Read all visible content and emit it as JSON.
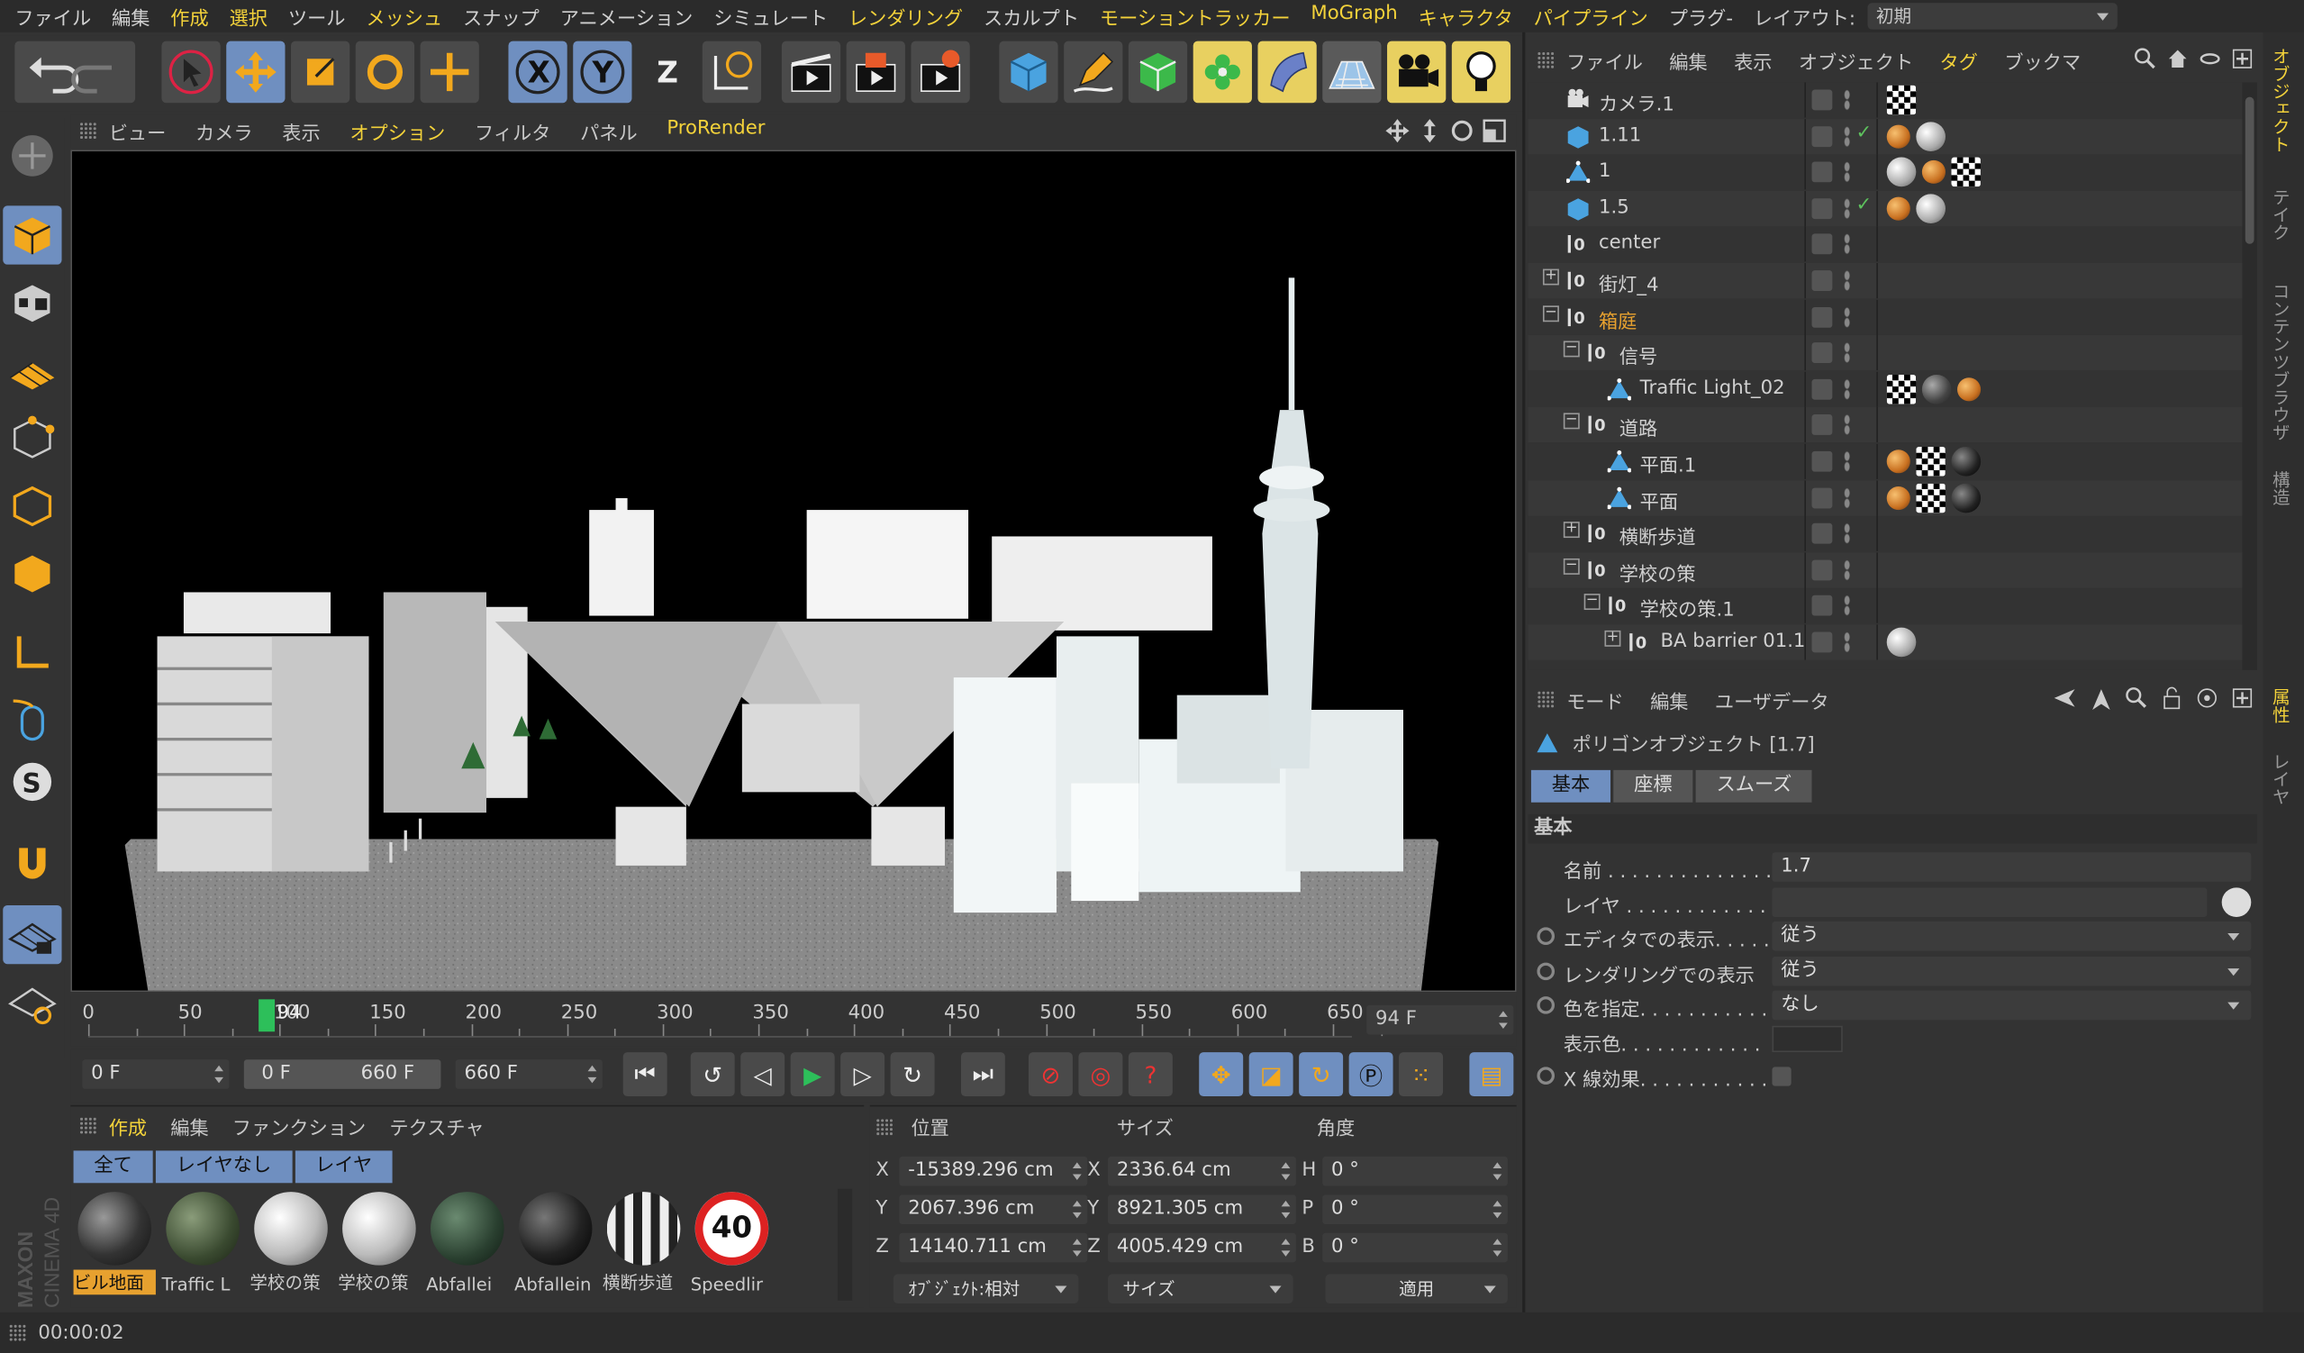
{
  "menubar": {
    "items": [
      {
        "label": "ファイル",
        "hl": false
      },
      {
        "label": "編集",
        "hl": false
      },
      {
        "label": "作成",
        "hl": true
      },
      {
        "label": "選択",
        "hl": true
      },
      {
        "label": "ツール",
        "hl": false
      },
      {
        "label": "メッシュ",
        "hl": true
      },
      {
        "label": "スナップ",
        "hl": false
      },
      {
        "label": "アニメーション",
        "hl": false
      },
      {
        "label": "シミュレート",
        "hl": false
      },
      {
        "label": "レンダリング",
        "hl": true
      },
      {
        "label": "スカルプト",
        "hl": false
      },
      {
        "label": "モーショントラッカー",
        "hl": true
      },
      {
        "label": "MoGraph",
        "hl": true
      },
      {
        "label": "キャラクタ",
        "hl": true
      },
      {
        "label": "パイプライン",
        "hl": true
      },
      {
        "label": "プラグ-",
        "hl": false
      }
    ],
    "layout_label": "レイアウト:",
    "layout_value": "初期"
  },
  "viewport_menu": [
    {
      "label": "ビュー",
      "hl": false
    },
    {
      "label": "カメラ",
      "hl": false
    },
    {
      "label": "表示",
      "hl": false
    },
    {
      "label": "オプション",
      "hl": true
    },
    {
      "label": "フィルタ",
      "hl": false
    },
    {
      "label": "パネル",
      "hl": false
    },
    {
      "label": "ProRender",
      "hl": true
    }
  ],
  "timeline": {
    "ticks": [
      "0",
      "50",
      "100",
      "150",
      "200",
      "250",
      "300",
      "350",
      "400",
      "450",
      "500",
      "550",
      "600",
      "650"
    ],
    "current": "94",
    "current_frame_field": "94 F",
    "max_frame": 660
  },
  "transport": {
    "start": "0 F",
    "range_start": "0 F",
    "range_end": "660 F",
    "end": "660 F"
  },
  "materials": {
    "menu": [
      {
        "label": "作成",
        "hl": true
      },
      {
        "label": "編集",
        "hl": false
      },
      {
        "label": "ファンクション",
        "hl": false
      },
      {
        "label": "テクスチャ",
        "hl": false
      }
    ],
    "tabs": [
      "全て",
      "レイヤなし",
      "レイヤ"
    ],
    "items": [
      {
        "label": "ビル地面",
        "style": "dark",
        "selected": true
      },
      {
        "label": "Traffic L",
        "style": "green",
        "selected": false
      },
      {
        "label": "学校の策",
        "style": "white",
        "selected": false
      },
      {
        "label": "学校の策",
        "style": "white",
        "selected": false
      },
      {
        "label": "Abfallei",
        "style": "darkgreen",
        "selected": false
      },
      {
        "label": "Abfallein",
        "style": "black",
        "selected": false
      },
      {
        "label": "横断歩道",
        "style": "stripe",
        "selected": false
      },
      {
        "label": "Speedlir",
        "style": "sign",
        "selected": false
      }
    ],
    "sign_text": "40"
  },
  "coords": {
    "headers": {
      "position": "位置",
      "size": "サイズ",
      "angle": "角度"
    },
    "axes": [
      {
        "pl": "X",
        "pv": "-15389.296 cm",
        "sl": "X",
        "sv": "2336.64 cm",
        "al": "H",
        "av": "0 °"
      },
      {
        "pl": "Y",
        "pv": "2067.396 cm",
        "sl": "Y",
        "sv": "8921.305 cm",
        "al": "P",
        "av": "0 °"
      },
      {
        "pl": "Z",
        "pv": "14140.711 cm",
        "sl": "Z",
        "sv": "4005.429 cm",
        "al": "B",
        "av": "0 °"
      }
    ],
    "mode": "ｵﾌﾞｼﾞｪｸﾄ:相対",
    "size_mode": "サイズ",
    "apply": "適用"
  },
  "status": {
    "time": "00:00:02"
  },
  "object_manager": {
    "menu": [
      {
        "label": "ファイル",
        "hl": false
      },
      {
        "label": "編集",
        "hl": false
      },
      {
        "label": "表示",
        "hl": false
      },
      {
        "label": "オブジェクト",
        "hl": false
      },
      {
        "label": "タグ",
        "hl": true
      },
      {
        "label": "ブックマ",
        "hl": false
      }
    ],
    "rows": [
      {
        "name": "カメラ.1",
        "indent": 0,
        "icon": "camera",
        "tree": "",
        "check": false,
        "tags": [
          "chk"
        ]
      },
      {
        "name": "1.11",
        "indent": 0,
        "icon": "cube",
        "tree": "",
        "check": true,
        "tags": [
          "orange",
          "white"
        ]
      },
      {
        "name": "1",
        "indent": 0,
        "icon": "poly",
        "tree": "",
        "check": false,
        "tags": [
          "white",
          "orange",
          "chk"
        ]
      },
      {
        "name": "1.5",
        "indent": 0,
        "icon": "cube",
        "tree": "",
        "check": true,
        "tags": [
          "orange",
          "white"
        ]
      },
      {
        "name": "center",
        "indent": 0,
        "icon": "null",
        "tree": "",
        "check": false,
        "tags": []
      },
      {
        "name": "街灯_4",
        "indent": 0,
        "icon": "null",
        "tree": "+",
        "check": false,
        "tags": []
      },
      {
        "name": "箱庭",
        "indent": 0,
        "icon": "null",
        "tree": "-",
        "check": false,
        "tags": [],
        "orange": true
      },
      {
        "name": "信号",
        "indent": 1,
        "icon": "null",
        "tree": "-",
        "check": false,
        "tags": []
      },
      {
        "name": "Traffic Light_02",
        "indent": 2,
        "icon": "poly",
        "tree": "",
        "check": false,
        "tags": [
          "chk",
          "dark",
          "orange"
        ]
      },
      {
        "name": "道路",
        "indent": 1,
        "icon": "null",
        "tree": "-",
        "check": false,
        "tags": []
      },
      {
        "name": "平面.1",
        "indent": 2,
        "icon": "poly",
        "tree": "",
        "check": false,
        "tags": [
          "orange",
          "chk",
          "black"
        ]
      },
      {
        "name": "平面",
        "indent": 2,
        "icon": "poly",
        "tree": "",
        "check": false,
        "tags": [
          "orange",
          "chk",
          "black"
        ]
      },
      {
        "name": "横断歩道",
        "indent": 1,
        "icon": "null",
        "tree": "+",
        "check": false,
        "tags": []
      },
      {
        "name": "学校の策",
        "indent": 1,
        "icon": "null",
        "tree": "-",
        "check": false,
        "tags": []
      },
      {
        "name": "学校の策.1",
        "indent": 2,
        "icon": "null",
        "tree": "-",
        "check": false,
        "tags": []
      },
      {
        "name": "BA barrier 01.1",
        "indent": 3,
        "icon": "null",
        "tree": "+",
        "check": false,
        "tags": [
          "white"
        ]
      }
    ]
  },
  "attributes": {
    "menu": [
      "モード",
      "編集",
      "ユーザデータ"
    ],
    "title": "ポリゴンオブジェクト [1.7]",
    "tabs": [
      {
        "label": "基本",
        "active": true
      },
      {
        "label": "座標",
        "active": false
      },
      {
        "label": "スムーズ",
        "active": false
      }
    ],
    "section": "基本",
    "fields": [
      {
        "label": "名前 . . . . . . . . . . . . . . .",
        "value": "1.7",
        "type": "text",
        "radio": false
      },
      {
        "label": "レイヤ . . . . . . . . . . . . . .",
        "value": "",
        "type": "layer",
        "radio": false
      },
      {
        "label": "エディタでの表示. . . . .",
        "value": "従う",
        "type": "dd",
        "radio": true
      },
      {
        "label": "レンダリングでの表示",
        "value": "従う",
        "type": "dd",
        "radio": true
      },
      {
        "label": "色を指定. . . . . . . . . . .",
        "value": "なし",
        "type": "dd",
        "radio": true
      },
      {
        "label": "表示色. . . . . . . . . . . .",
        "value": "",
        "type": "swatch",
        "radio": false
      },
      {
        "label": "X 線効果. . . . . . . . . . .",
        "value": "",
        "type": "check",
        "radio": true
      }
    ]
  },
  "side_tabs": {
    "top": [
      {
        "label": "オブジェクト",
        "hl": true
      },
      {
        "label": "テイク",
        "hl": false
      },
      {
        "label": "コンテンツブラウザ",
        "hl": false
      },
      {
        "label": "構造",
        "hl": false
      }
    ],
    "bottom": [
      {
        "label": "属性",
        "hl": true
      },
      {
        "label": "レイヤ",
        "hl": false
      }
    ]
  },
  "brand": {
    "maker": "MAXON",
    "product": "CINEMA 4D"
  }
}
